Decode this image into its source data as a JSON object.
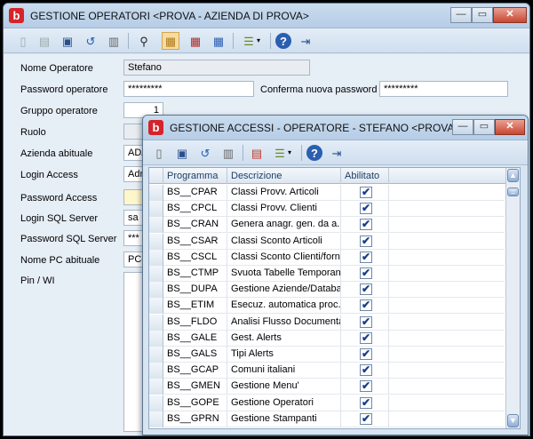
{
  "main_window": {
    "title": "GESTIONE OPERATORI <PROVA - AZIENDA DI PROVA>",
    "win_controls": {
      "min": "—",
      "max": "▭",
      "close": "✕"
    },
    "fields": {
      "nome_operatore": {
        "label": "Nome Operatore",
        "value": "Stefano"
      },
      "password_operatore": {
        "label": "Password operatore",
        "value": "*********"
      },
      "conferma_password": {
        "label": "Conferma nuova password",
        "value": "*********"
      },
      "gruppo_operatore": {
        "label": "Gruppo operatore",
        "value": "1"
      },
      "ruolo": {
        "label": "Ruolo",
        "value": ""
      },
      "azienda_abituale": {
        "label": "Azienda abituale",
        "value": "ADA"
      },
      "login_access": {
        "label": "Login Access",
        "value": "Adm"
      },
      "password_access": {
        "label": "Password Access",
        "value": ""
      },
      "login_sql_server": {
        "label": "Login SQL Server",
        "value": "sa"
      },
      "password_sql_server": {
        "label": "Password SQL Server",
        "value": "***"
      },
      "nome_pc_abituale": {
        "label": "Nome PC abituale",
        "value": "PC-"
      },
      "pin_wi": {
        "label": "Pin / WI",
        "value": ""
      }
    }
  },
  "access_window": {
    "title": "GESTIONE ACCESSI - OPERATORE - STEFANO <PROVA - AZIEN...",
    "win_controls": {
      "min": "—",
      "max": "▭",
      "close": "✕"
    },
    "columns": {
      "programma": "Programma",
      "descrizione": "Descrizione",
      "abilitato": "Abilitato"
    },
    "rows": [
      {
        "programma": "BS__CPAR",
        "descrizione": "Classi Provv. Articoli",
        "abilitato": true
      },
      {
        "programma": "BS__CPCL",
        "descrizione": "Classi Provv. Clienti",
        "abilitato": true
      },
      {
        "programma": "BS__CRAN",
        "descrizione": "Genera anagr. gen. da a...",
        "abilitato": true
      },
      {
        "programma": "BS__CSAR",
        "descrizione": "Classi Sconto Articoli",
        "abilitato": true
      },
      {
        "programma": "BS__CSCL",
        "descrizione": "Classi Sconto Clienti/forn",
        "abilitato": true
      },
      {
        "programma": "BS__CTMP",
        "descrizione": "Svuota Tabelle Temporanee",
        "abilitato": true
      },
      {
        "programma": "BS__DUPA",
        "descrizione": "Gestione Aziende/Database",
        "abilitato": true
      },
      {
        "programma": "BS__ETIM",
        "descrizione": "Esecuz. automatica proc....",
        "abilitato": true
      },
      {
        "programma": "BS__FLDO",
        "descrizione": "Analisi Flusso Documentale",
        "abilitato": true
      },
      {
        "programma": "BS__GALE",
        "descrizione": "Gest. Alerts",
        "abilitato": true
      },
      {
        "programma": "BS__GALS",
        "descrizione": "Tipi Alerts",
        "abilitato": true
      },
      {
        "programma": "BS__GCAP",
        "descrizione": "Comuni italiani",
        "abilitato": true
      },
      {
        "programma": "BS__GMEN",
        "descrizione": "Gestione Menu'",
        "abilitato": true
      },
      {
        "programma": "BS__GOPE",
        "descrizione": "Gestione Operatori",
        "abilitato": true
      },
      {
        "programma": "BS__GPRN",
        "descrizione": "Gestione Stampanti",
        "abilitato": true
      }
    ]
  },
  "icons": {
    "app": "b",
    "check": "✔"
  },
  "colors": {
    "accent": "#d4242a",
    "window_bg": "#d7e5f3",
    "selected_tool": "#f5dca0"
  }
}
